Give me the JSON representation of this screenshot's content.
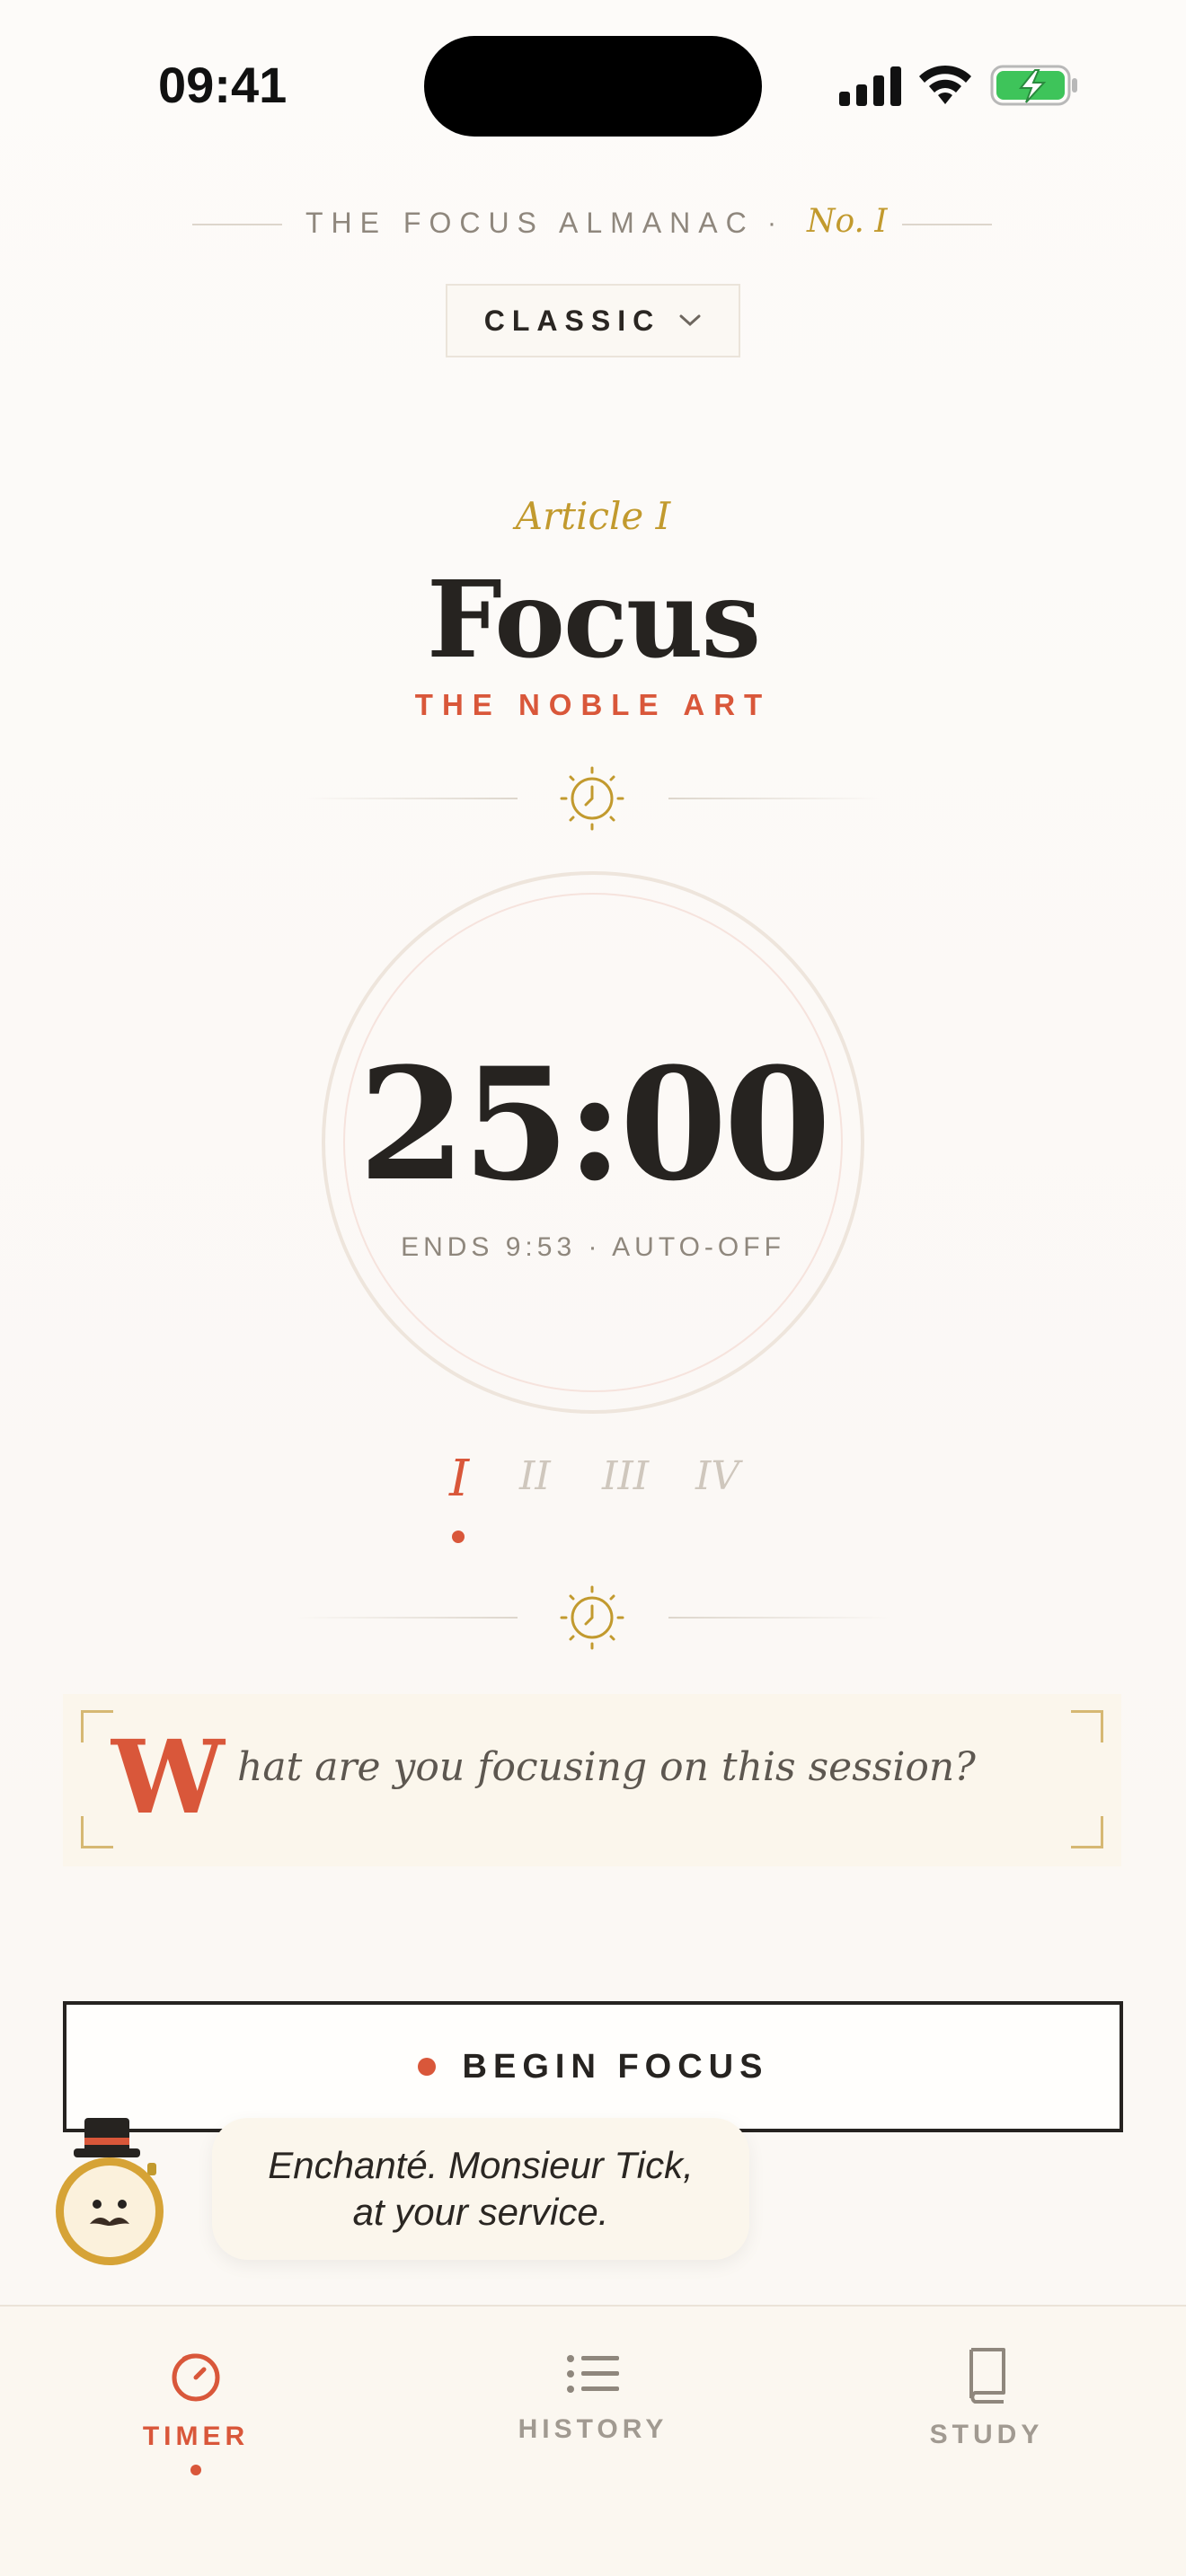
{
  "status_bar": {
    "time": "09:41",
    "icons": [
      "signal-icon",
      "wifi-icon",
      "battery-charging-icon"
    ],
    "battery_color": "#3ec45a"
  },
  "masthead": {
    "title": "THE FOCUS ALMANAC",
    "separator": "·",
    "issue": "No. I"
  },
  "mode_dropdown": {
    "selected": "CLASSIC",
    "icon": "chevron-down-icon"
  },
  "article": {
    "kicker": "Article I",
    "title": "Focus",
    "subtitle": "THE NOBLE ART"
  },
  "timer": {
    "display": "25:00",
    "subtitle": "ENDS 9:53 · AUTO-OFF"
  },
  "rounds": {
    "items": [
      "I",
      "II",
      "III",
      "IV"
    ],
    "active_index": 0
  },
  "prompt": {
    "drop_cap": "W",
    "text": "hat are you focusing on this session?"
  },
  "begin_button": {
    "label": "BEGIN FOCUS"
  },
  "mascot": {
    "message_line1": "Enchanté. Monsieur Tick,",
    "message_line2": "at your service."
  },
  "tabs": [
    {
      "label": "TIMER",
      "icon": "timer-icon",
      "active": true
    },
    {
      "label": "HISTORY",
      "icon": "list-icon",
      "active": false
    },
    {
      "label": "STUDY",
      "icon": "book-icon",
      "active": false
    }
  ],
  "colors": {
    "accent": "#d9573a",
    "gold": "#c29a2e",
    "ink": "#262320",
    "muted": "#8f877d",
    "paper": "#fbf6ec"
  }
}
